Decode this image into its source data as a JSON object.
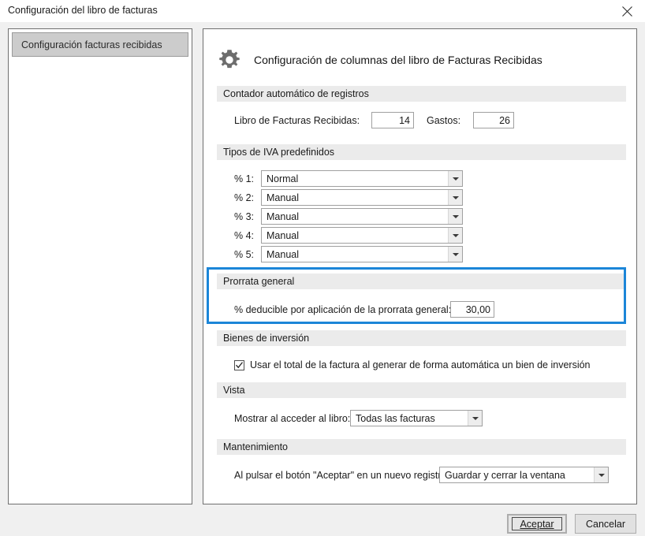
{
  "window": {
    "title": "Configuración del libro de facturas",
    "close_icon": "close-icon"
  },
  "sidebar": {
    "items": [
      {
        "label": "Configuración facturas recibidas",
        "selected": true
      }
    ]
  },
  "panel": {
    "icon": "gear-icon",
    "title": "Configuración de columnas del libro de Facturas Recibidas"
  },
  "sections": {
    "counter": {
      "header": "Contador automático de registros",
      "fields": [
        {
          "label": "Libro de Facturas Recibidas:",
          "value": "14"
        },
        {
          "label": "Gastos:",
          "value": "26"
        }
      ]
    },
    "vat": {
      "header": "Tipos de IVA predefinidos",
      "rows": [
        {
          "label": "% 1:",
          "value": "Normal"
        },
        {
          "label": "% 2:",
          "value": "Manual"
        },
        {
          "label": "% 3:",
          "value": "Manual"
        },
        {
          "label": "% 4:",
          "value": "Manual"
        },
        {
          "label": "% 5:",
          "value": "Manual"
        }
      ]
    },
    "prorrata": {
      "header": "Prorrata general",
      "label": "% deducible por aplicación de la prorrata general:",
      "value": "30,00",
      "highlight_color": "#1c86d8"
    },
    "capital_goods": {
      "header": "Bienes de inversión",
      "checkbox_label": "Usar el total de la factura al generar de forma automática un bien de inversión",
      "checked": true
    },
    "view": {
      "header": "Vista",
      "label": "Mostrar al acceder al libro:",
      "value": "Todas las facturas"
    },
    "maintenance": {
      "header": "Mantenimiento",
      "label": "Al pulsar el botón \"Aceptar\" en un nuevo registro:",
      "value": "Guardar y cerrar la ventana"
    }
  },
  "footer": {
    "accept_label": "Aceptar",
    "cancel_label": "Cancelar"
  }
}
